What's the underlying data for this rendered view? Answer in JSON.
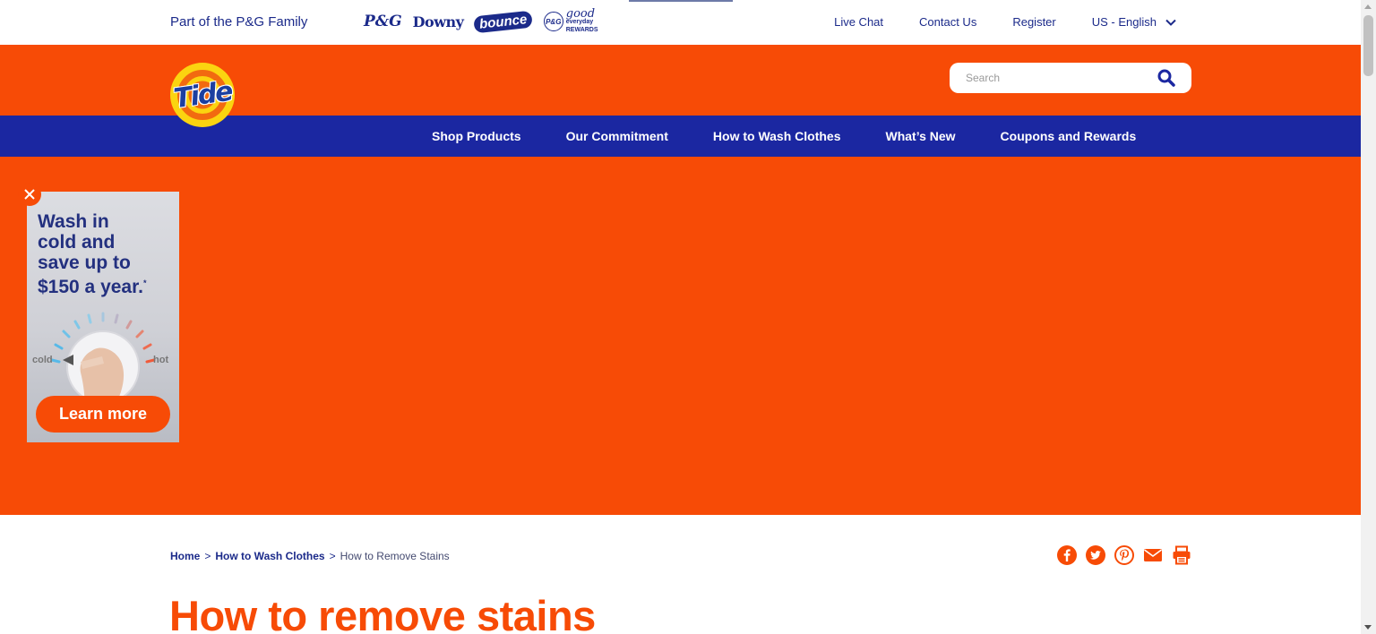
{
  "colors": {
    "orange": "#f74b06",
    "navy": "#1b27a1",
    "link": "#1b2a8a",
    "yellow": "#fbd410"
  },
  "topbar": {
    "family_text": "Part of the P&G Family",
    "brands": {
      "pg": "P&G",
      "downy": "Downy",
      "bounce": "bounce",
      "rewards_circle": "P&G",
      "rewards_good": "good",
      "rewards_small": "everyday",
      "rewards_label": "REWARDS"
    },
    "links": [
      "Live Chat",
      "Contact Us",
      "Register"
    ],
    "language": "US - English",
    "language_icon": "chevron-down-icon"
  },
  "header": {
    "logo_text": "Tide",
    "search": {
      "placeholder": "Search",
      "value": "",
      "icon": "search-icon"
    }
  },
  "nav": {
    "items": [
      "Shop Products",
      "Our Commitment",
      "How to Wash Clothes",
      "What’s New",
      "Coupons and Rewards"
    ]
  },
  "ad": {
    "headline_1": "Wash in",
    "headline_2": "cold and",
    "headline_3": "save up to",
    "headline_4": "$150 a year.",
    "asterisk": "*",
    "cold_label": "cold",
    "hot_label": "hot",
    "cta": "Learn more",
    "close_icon": "close-icon"
  },
  "breadcrumb": {
    "home": "Home",
    "sep": ">",
    "section": "How to Wash Clothes",
    "current": "How to Remove Stains"
  },
  "share_icons": [
    "facebook-icon",
    "twitter-icon",
    "pinterest-icon",
    "email-icon",
    "print-icon"
  ],
  "page": {
    "title": "How to remove stains"
  }
}
